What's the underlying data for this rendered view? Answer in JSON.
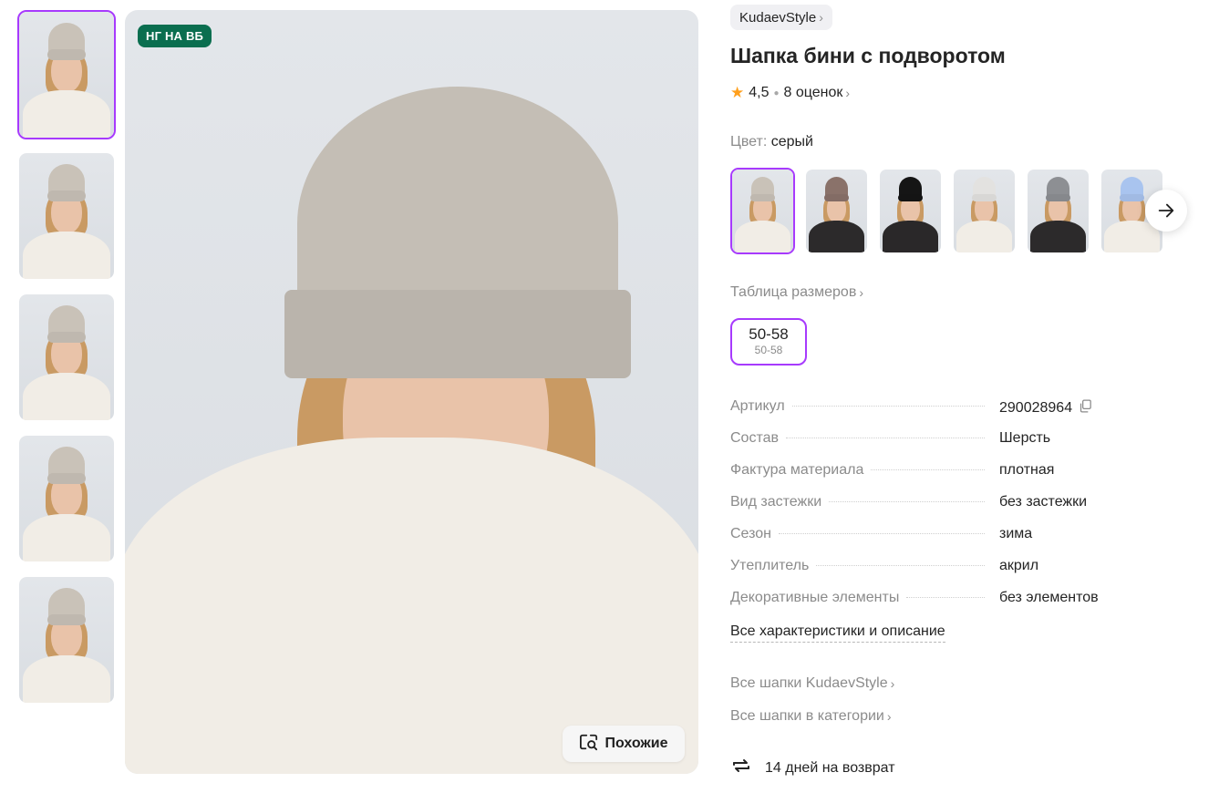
{
  "gallery": {
    "thumbnails": [
      {
        "hat_color": "#c9c2b8",
        "active": true
      },
      {
        "hat_color": "#c9c2b8",
        "active": false
      },
      {
        "hat_color": "#c9c2b8",
        "active": false
      },
      {
        "hat_color": "#c9c2b8",
        "active": false
      },
      {
        "hat_color": "#c9c2b8",
        "active": false
      }
    ],
    "main_hat_color": "#c4beb5",
    "badge": "НГ НА ВБ",
    "badge_color": "#0a6e4f",
    "similar_label": "Похожие"
  },
  "product": {
    "brand": "KudaevStyle",
    "title": "Шапка бини с подворотом",
    "rating": "4,5",
    "reviews": "8 оценок",
    "color_label": "Цвет:",
    "color_value": "серый",
    "swatches": [
      {
        "hat_color": "#c9c2b8",
        "coat": "#f1ede6",
        "active": true
      },
      {
        "hat_color": "#8a726a",
        "coat": "#2c2a2b",
        "active": false
      },
      {
        "hat_color": "#151515",
        "coat": "#2a2829",
        "active": false
      },
      {
        "hat_color": "#e3e2e0",
        "coat": "#f1ede6",
        "active": false
      },
      {
        "hat_color": "#8d8f93",
        "coat": "#2c2a2b",
        "active": false
      },
      {
        "hat_color": "#a9c4ef",
        "coat": "#f1ede6",
        "active": false
      }
    ],
    "size_table_label": "Таблица размеров",
    "size": {
      "main": "50-58",
      "sub": "50-58"
    },
    "specs": [
      {
        "key": "Артикул",
        "value": "290028964",
        "copy": true
      },
      {
        "key": "Состав",
        "value": "Шерсть"
      },
      {
        "key": "Фактура материала",
        "value": "плотная"
      },
      {
        "key": "Вид застежки",
        "value": "без застежки"
      },
      {
        "key": "Сезон",
        "value": "зима"
      },
      {
        "key": "Утеплитель",
        "value": "акрил"
      },
      {
        "key": "Декоративные элементы",
        "value": "без элементов"
      }
    ],
    "all_specs_label": "Все характеристики и описание",
    "brand_hats_link": "Все шапки KudaevStyle",
    "category_hats_link": "Все шапки в категории",
    "returns_label": "14 дней на возврат"
  },
  "colors": {
    "accent": "#a73afd",
    "star": "#ff9f1c",
    "muted_text": "#8b8b8b"
  }
}
